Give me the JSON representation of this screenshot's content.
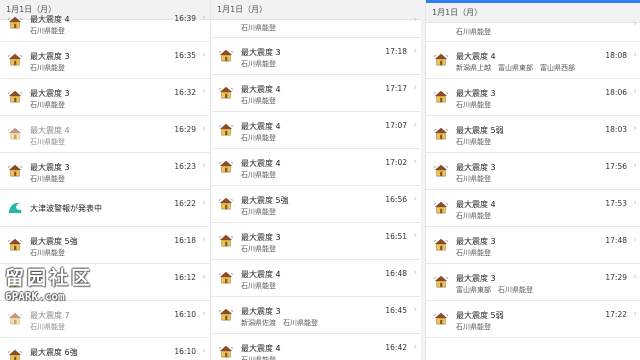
{
  "columns": [
    {
      "date_header": "1月1日（月）",
      "rows": [
        {
          "type": "quake",
          "partial": false,
          "dim": false,
          "title": "最大震度 4",
          "sub": "石川県能登",
          "time": "16:39"
        },
        {
          "type": "quake",
          "partial": false,
          "dim": false,
          "title": "最大震度 3",
          "sub": "石川県能登",
          "time": "16:35"
        },
        {
          "type": "quake",
          "partial": false,
          "dim": false,
          "title": "最大震度 3",
          "sub": "石川県能登",
          "time": "16:32"
        },
        {
          "type": "quake",
          "partial": false,
          "dim": true,
          "title": "最大震度 4",
          "sub": "石川県能登",
          "time": "16:29"
        },
        {
          "type": "quake",
          "partial": false,
          "dim": false,
          "title": "最大震度 3",
          "sub": "石川県能登",
          "time": "16:23"
        },
        {
          "type": "tsunami",
          "partial": false,
          "dim": false,
          "title": "大津波警報が発表中",
          "sub": "",
          "time": "16:22"
        },
        {
          "type": "quake",
          "partial": false,
          "dim": false,
          "title": "最大震度 5強",
          "sub": "石川県能登",
          "time": "16:18"
        },
        {
          "type": "quake",
          "partial": false,
          "dim": false,
          "title": "",
          "sub": "",
          "time": "16:12"
        },
        {
          "type": "quake",
          "partial": false,
          "dim": true,
          "title": "最大震度 7",
          "sub": "石川県能登",
          "time": "16:10"
        },
        {
          "type": "quake",
          "partial": false,
          "dim": false,
          "title": "最大震度 6強",
          "sub": "石川県能登",
          "time": "16:10"
        }
      ]
    },
    {
      "date_header": "1月1日（月）",
      "rows": [
        {
          "type": "quake",
          "partial": true,
          "dim": false,
          "title": "",
          "sub": "石川県能登",
          "time": ""
        },
        {
          "type": "quake",
          "partial": false,
          "dim": false,
          "title": "最大震度 3",
          "sub": "石川県能登",
          "time": "17:18"
        },
        {
          "type": "quake",
          "partial": false,
          "dim": false,
          "title": "最大震度 4",
          "sub": "石川県能登",
          "time": "17:17"
        },
        {
          "type": "quake",
          "partial": false,
          "dim": false,
          "title": "最大震度 4",
          "sub": "石川県能登",
          "time": "17:07"
        },
        {
          "type": "quake",
          "partial": false,
          "dim": false,
          "title": "最大震度 4",
          "sub": "石川県能登",
          "time": "17:02"
        },
        {
          "type": "quake",
          "partial": false,
          "dim": false,
          "title": "最大震度 5強",
          "sub": "石川県能登",
          "time": "16:56"
        },
        {
          "type": "quake",
          "partial": false,
          "dim": false,
          "title": "最大震度 3",
          "sub": "石川県能登",
          "time": "16:51"
        },
        {
          "type": "quake",
          "partial": false,
          "dim": false,
          "title": "最大震度 4",
          "sub": "石川県能登",
          "time": "16:48"
        },
        {
          "type": "quake",
          "partial": false,
          "dim": false,
          "title": "最大震度 3",
          "sub": "新潟県佐渡　石川県能登",
          "time": "16:45"
        },
        {
          "type": "quake",
          "partial": false,
          "dim": false,
          "title": "最大震度 4",
          "sub": "石川県能登",
          "time": "16:42"
        }
      ]
    },
    {
      "date_header": "1月1日（月）",
      "rows": [
        {
          "type": "quake",
          "partial": true,
          "dim": false,
          "title": "",
          "sub": "石川県能登",
          "time": ""
        },
        {
          "type": "quake",
          "partial": false,
          "dim": false,
          "title": "最大震度 4",
          "sub": "新潟県上越　富山県東部　富山県西部",
          "time": "18:08"
        },
        {
          "type": "quake",
          "partial": false,
          "dim": false,
          "title": "最大震度 3",
          "sub": "石川県能登",
          "time": "18:06"
        },
        {
          "type": "quake",
          "partial": false,
          "dim": false,
          "title": "最大震度 5弱",
          "sub": "石川県能登",
          "time": "18:03"
        },
        {
          "type": "quake",
          "partial": false,
          "dim": false,
          "title": "最大震度 3",
          "sub": "石川県能登",
          "time": "17:56"
        },
        {
          "type": "quake",
          "partial": false,
          "dim": false,
          "title": "最大震度 4",
          "sub": "石川県能登",
          "time": "17:53"
        },
        {
          "type": "quake",
          "partial": false,
          "dim": false,
          "title": "最大震度 3",
          "sub": "石川県能登",
          "time": "17:48"
        },
        {
          "type": "quake",
          "partial": false,
          "dim": false,
          "title": "最大震度 3",
          "sub": "富山県東部　石川県能登",
          "time": "17:29"
        },
        {
          "type": "quake",
          "partial": false,
          "dim": false,
          "title": "最大震度 5弱",
          "sub": "石川県能登",
          "time": "17:22"
        }
      ]
    }
  ],
  "watermark": {
    "cjk": "留园社区",
    "url": "6PARK.com"
  },
  "icons": {
    "quake": "house-quake-icon",
    "tsunami": "tsunami-wave-icon",
    "chevron": "chevron-right-icon"
  },
  "colors": {
    "accent": "#2f80ed",
    "wave": "#2bb7a8",
    "roof": "#8a4b2a",
    "wall": "#f2c250"
  }
}
